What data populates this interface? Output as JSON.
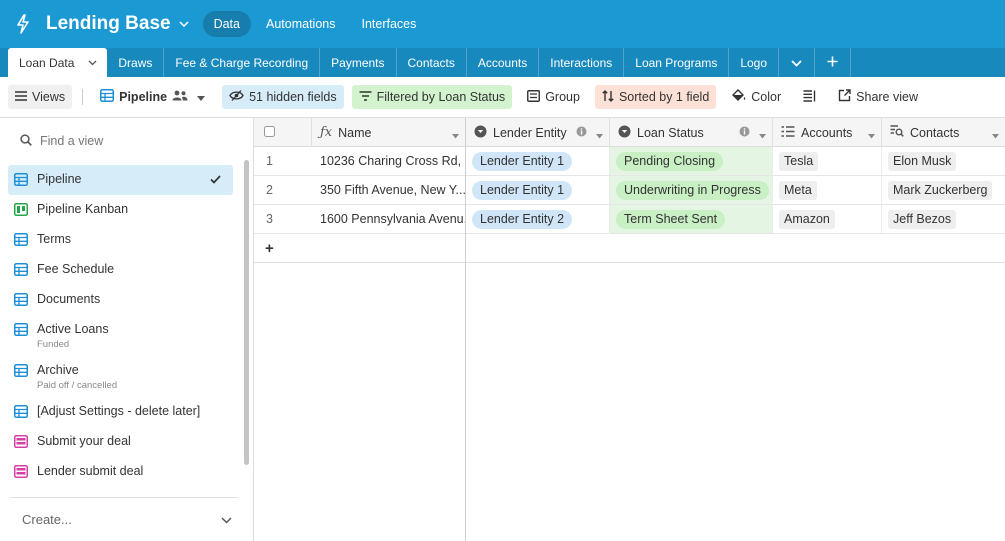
{
  "app": {
    "base_name": "Lending Base",
    "nav": [
      {
        "label": "Data",
        "active": true
      },
      {
        "label": "Automations",
        "active": false
      },
      {
        "label": "Interfaces",
        "active": false
      }
    ]
  },
  "tabs": [
    {
      "label": "Loan Data",
      "active": true
    },
    {
      "label": "Draws"
    },
    {
      "label": "Fee & Charge Recording"
    },
    {
      "label": "Payments"
    },
    {
      "label": "Contacts"
    },
    {
      "label": "Accounts"
    },
    {
      "label": "Interactions"
    },
    {
      "label": "Loan Programs"
    },
    {
      "label": "Logo"
    }
  ],
  "toolbar": {
    "views_label": "Views",
    "current_view": "Pipeline",
    "hidden_fields": "51 hidden fields",
    "filter": "Filtered by Loan Status",
    "group": "Group",
    "sort": "Sorted by 1 field",
    "color": "Color",
    "share": "Share view"
  },
  "sidebar": {
    "search_placeholder": "Find a view",
    "create_label": "Create...",
    "views": [
      {
        "label": "Pipeline",
        "type": "grid",
        "active": true
      },
      {
        "label": "Pipeline Kanban",
        "type": "kanban"
      },
      {
        "label": "Terms",
        "type": "grid"
      },
      {
        "label": "Fee Schedule",
        "type": "grid"
      },
      {
        "label": "Documents",
        "type": "grid"
      },
      {
        "label": "Active Loans",
        "sub": "Funded",
        "type": "grid"
      },
      {
        "label": "Archive",
        "sub": "Paid off / cancelled",
        "type": "grid"
      },
      {
        "label": "[Adjust Settings - delete later]",
        "type": "grid"
      },
      {
        "label": "Submit your deal",
        "type": "form"
      },
      {
        "label": "Lender submit deal",
        "type": "form"
      }
    ]
  },
  "grid": {
    "columns": [
      {
        "label": "Name",
        "icon": "formula-icon"
      },
      {
        "label": "Lender Entity",
        "icon": "single-select-icon"
      },
      {
        "label": "Loan Status",
        "icon": "single-select-icon"
      },
      {
        "label": "Accounts",
        "icon": "link-icon"
      },
      {
        "label": "Contacts",
        "icon": "lookup-icon"
      }
    ],
    "rows": [
      {
        "num": "1",
        "name": "10236 Charing Cross Rd, ...",
        "lender": "Lender Entity 1",
        "status": "Pending Closing",
        "account": "Tesla",
        "contact": "Elon Musk"
      },
      {
        "num": "2",
        "name": "350 Fifth Avenue, New Y...",
        "lender": "Lender Entity 1",
        "status": "Underwriting in Progress",
        "account": "Meta",
        "contact": "Mark Zuckerberg"
      },
      {
        "num": "3",
        "name": "1600 Pennsylvania Avenu...",
        "lender": "Lender Entity 2",
        "status": "Term Sheet Sent",
        "account": "Amazon",
        "contact": "Jeff Bezos"
      }
    ],
    "add_row_symbol": "+"
  },
  "colors": {
    "topbar": "#1b99d2",
    "tabsbar": "#1889bd",
    "hidden_bg": "#d6ecf8",
    "filter_bg": "#d3f3cf",
    "sort_bg": "#fde1d6",
    "grid_icon": "#1d8fd6",
    "kanban_icon": "#2aa44a",
    "form_icon": "#d63fa6"
  }
}
